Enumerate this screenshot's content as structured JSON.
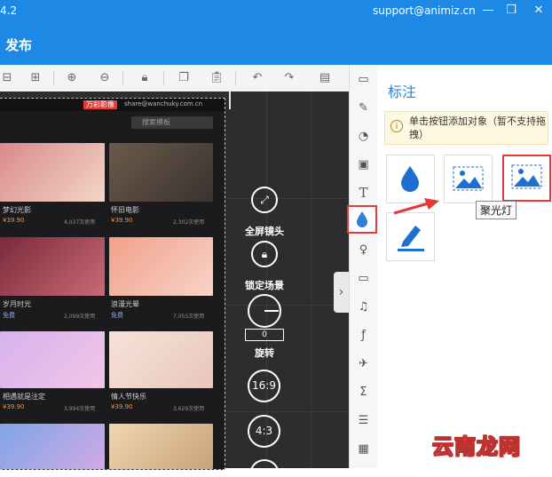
{
  "window": {
    "version": "4.2",
    "email": "support@animiz.cn",
    "controls": [
      "—",
      "❐",
      "✕"
    ]
  },
  "menu": {
    "publish_label": "发布"
  },
  "preview": {
    "badge": "万彩影像",
    "account": "share@wanchuky.com.cn",
    "search_placeholder": "搜索模板",
    "items": [
      {
        "title": "梦幻光影",
        "price": "¥39.90",
        "count": "4,037次使用",
        "colors": [
          "#d98a8a",
          "#f3d6c7"
        ]
      },
      {
        "title": "怀旧电影",
        "price": "¥39.90",
        "count": "2,302次使用",
        "colors": [
          "#6b5a4a",
          "#3a3330"
        ]
      },
      {
        "title": "岁月时光",
        "price": "免费",
        "count": "2,099次使用",
        "colors": [
          "#7a2a3a",
          "#c96a77"
        ]
      },
      {
        "title": "浪漫光晕",
        "price": "免费",
        "count": "7,055次使用",
        "colors": [
          "#f3a08a",
          "#f6d4c8"
        ]
      },
      {
        "title": "相遇就是注定",
        "price": "¥39.90",
        "count": "3,994次使用",
        "colors": [
          "#d7b2ef",
          "#f1c6e7"
        ]
      },
      {
        "title": "情人节快乐",
        "price": "¥39.90",
        "count": "3,629次使用",
        "colors": [
          "#f6e3d9",
          "#e9c6ba"
        ]
      },
      {
        "title": "",
        "price": "",
        "count": "",
        "colors": [
          "#7ea6e6",
          "#d2a9e6"
        ]
      },
      {
        "title": "",
        "price": "",
        "count": "",
        "colors": [
          "#f0d6b0",
          "#c9a27a"
        ]
      }
    ]
  },
  "canvas_controls": {
    "fullscreen_label": "全屏镜头",
    "lock_label": "锁定场景",
    "rotation_value": "0",
    "rotate_label": "旋转",
    "ratio_169": "16:9",
    "ratio_43": "4:3"
  },
  "panel": {
    "title": "标注",
    "notice": "单击按钮添加对象（暂不支持拖拽）",
    "tooltip": "聚光灯"
  },
  "watermark": "云南龙网",
  "colors": {
    "brand": "#1e88e5",
    "highlight": "#e53935",
    "canvas": "#2d2d30"
  }
}
